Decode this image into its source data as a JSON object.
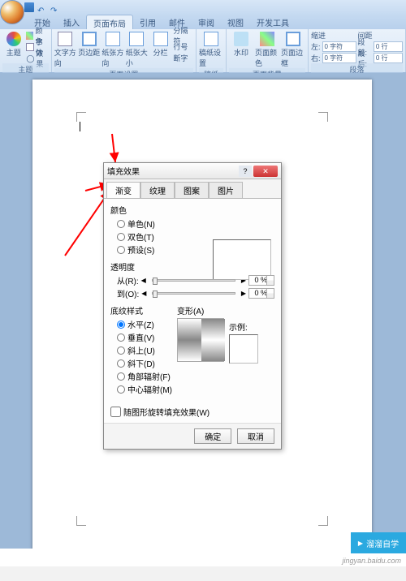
{
  "titlebar": {
    "title": ""
  },
  "ribbon_tabs": [
    "开始",
    "插入",
    "页面布局",
    "引用",
    "邮件",
    "审阅",
    "视图",
    "开发工具"
  ],
  "active_tab_index": 2,
  "ribbon": {
    "g_theme": {
      "label": "主题",
      "btn_theme": "主题",
      "opt_colors": "颜色",
      "opt_fonts": "字体",
      "opt_effects": "效果"
    },
    "g_page_setup": {
      "label": "页面设置",
      "btn_textdir": "文字方向",
      "btn_margins": "页边距",
      "btn_orient": "纸张方向",
      "btn_size": "纸张大小",
      "btn_columns": "分栏",
      "opt_breaks": "分隔符",
      "opt_lines": "行号",
      "opt_hyphen": "断字"
    },
    "g_paper": {
      "label": "稿纸",
      "btn_paper": "稿纸设置"
    },
    "g_pagebg": {
      "label": "页面背景",
      "btn_watermark": "水印",
      "btn_pagecolor": "页面颜色",
      "btn_border": "页面边框"
    },
    "g_para": {
      "label": "段落",
      "l_indent": "缩进",
      "l_spacing": "间距",
      "indent_left_label": "左:",
      "indent_left": "0 字符",
      "indent_right_label": "右:",
      "indent_right": "0 字符",
      "space_before_label": "段前:",
      "space_before": "0 行",
      "space_after_label": "段后:",
      "space_after": "0 行"
    }
  },
  "dialog": {
    "title": "填充效果",
    "tabs": [
      "渐变",
      "纹理",
      "图案",
      "图片"
    ],
    "active_tab_index": 0,
    "colors_label": "颜色",
    "color_opts": [
      "单色(N)",
      "双色(T)",
      "预设(S)"
    ],
    "trans_label": "透明度",
    "trans_from_label": "从(R):",
    "trans_from_val": "0 %",
    "trans_to_label": "到(O):",
    "trans_to_val": "0 %",
    "shade_label": "底纹样式",
    "variant_label": "变形(A)",
    "shade_opts": [
      "水平(Z)",
      "垂直(V)",
      "斜上(U)",
      "斜下(D)",
      "角部辐射(F)",
      "中心辐射(M)"
    ],
    "sample_label": "示例:",
    "rotate_chk": "随图形旋转填充效果(W)",
    "btn_ok": "确定",
    "btn_cancel": "取消"
  },
  "brand": "溜溜自学",
  "source": "jingyan.baidu.com"
}
